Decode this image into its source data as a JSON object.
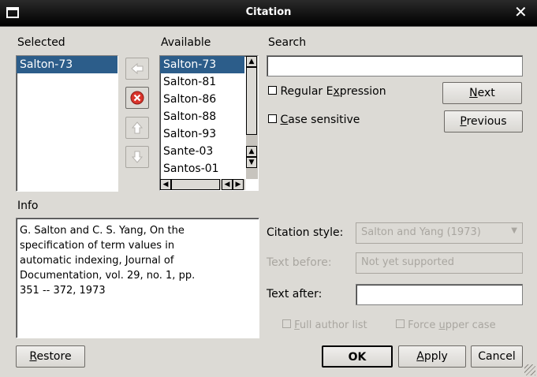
{
  "window": {
    "title": "Citation"
  },
  "selected": {
    "label": "Selected",
    "items": [
      "Salton-73"
    ]
  },
  "available": {
    "label": "Available",
    "items": [
      "Salton-73",
      "Salton-81",
      "Salton-86",
      "Salton-88",
      "Salton-93",
      "Sante-03",
      "Santos-01"
    ]
  },
  "search": {
    "label": "Search",
    "value": "",
    "regex_label": "Regular Expression",
    "regex_key": "x",
    "case_label": "Case sensitive",
    "case_key": "C",
    "next_label": "Next",
    "previous_label": "Previous"
  },
  "info": {
    "label": "Info",
    "lines": [
      "G. Salton and C. S. Yang, On the",
      "specification of term values in",
      "automatic indexing, Journal of",
      "Documentation, vol. 29, no. 1, pp.",
      "351 -- 372, 1973"
    ]
  },
  "style": {
    "citation_style_label": "Citation style:",
    "citation_style_value": "Salton and Yang (1973)",
    "text_before_label": "Text before:",
    "text_before_value": "Not yet supported",
    "text_after_label": "Text after:",
    "text_after_value": "",
    "full_author_label": "Full author list",
    "force_upper_label": "Force upper case"
  },
  "buttons": {
    "restore": "Restore",
    "ok": "OK",
    "apply": "Apply",
    "cancel": "Cancel"
  },
  "colors": {
    "selection": "#2c5d8a",
    "background": "#dcdad5"
  }
}
